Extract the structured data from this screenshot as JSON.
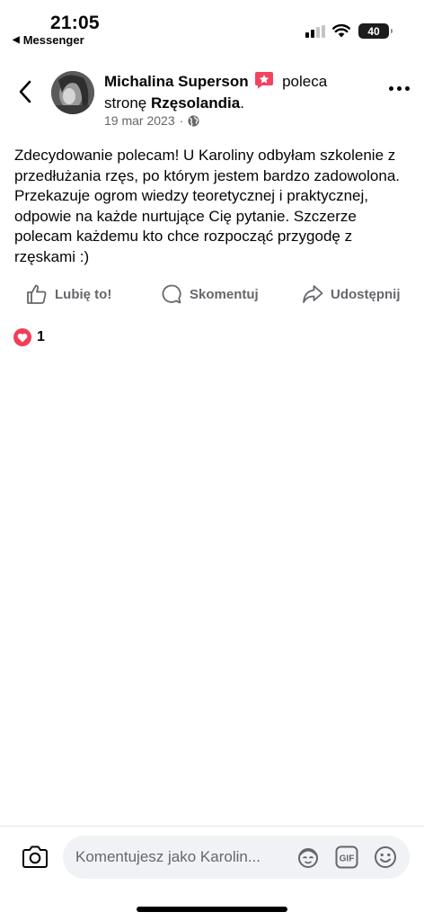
{
  "status_bar": {
    "time": "21:05",
    "back_app": "Messenger",
    "battery": "40"
  },
  "post": {
    "author": "Michalina Superson",
    "recommends_text": "poleca",
    "page_prefix": "stronę",
    "page_name": "Rzęsolandia",
    "page_suffix": ".",
    "date": "19 mar 2023",
    "dot": "·",
    "visibility_icon": "globe-icon",
    "body": "Zdecydowanie polecam! U Karoliny odbyłam szkolenie z przedłużania rzęs, po którym jestem bardzo zadowolona. Przekazuje ogrom wiedzy teoretycznej i praktycznej, odpowie na każde nurtujące Cię pytanie. Szczerze polecam każdemu kto chce rozpocząć przygodę z rzęskami :)"
  },
  "actions": {
    "like_label": "Lubię to!",
    "comment_label": "Skomentuj",
    "share_label": "Udostępnij"
  },
  "reactions": {
    "count": "1",
    "icon": "heart-icon"
  },
  "composer": {
    "placeholder": "Komentujesz jako Karolin..."
  },
  "colors": {
    "text": "#050505",
    "secondary": "#65676b",
    "heart": "#f33e58",
    "recommend_badge": "#f3425f",
    "input_bg": "#f0f2f5"
  }
}
